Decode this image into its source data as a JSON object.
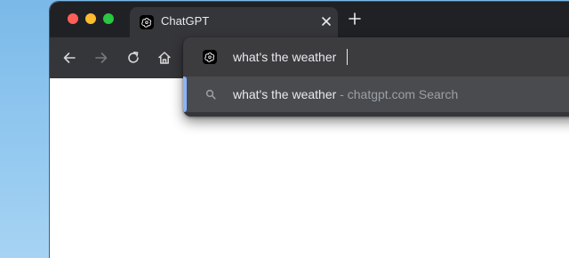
{
  "colors": {
    "tabstrip_bg": "#202124",
    "toolbar_bg": "#35363a",
    "accent": "#8ab4f8",
    "traffic_red": "#ff5f57",
    "traffic_yellow": "#febc2e",
    "traffic_green": "#28c840"
  },
  "tab": {
    "title": "ChatGPT",
    "favicon": "chatgpt-logo-icon"
  },
  "toolbar": {
    "back_icon": "arrow-left-icon",
    "forward_icon": "arrow-right-icon",
    "reload_icon": "reload-icon",
    "home_icon": "home-icon"
  },
  "omnibox": {
    "value": "what's the weather",
    "favicon": "chatgpt-logo-icon"
  },
  "suggestions": [
    {
      "icon": "search-icon",
      "query": "what's the weather",
      "separator": " - ",
      "provider": "chatgpt.com Search"
    }
  ]
}
